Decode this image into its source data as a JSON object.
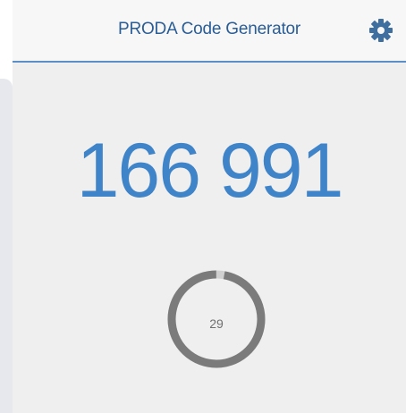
{
  "header": {
    "title": "PRODA Code Generator",
    "settings_icon": "gear-icon"
  },
  "code": {
    "value": "166 991"
  },
  "timer": {
    "seconds_remaining": "29",
    "progress": 0.97
  },
  "colors": {
    "accent": "#3f83c8",
    "title": "#2a5d96",
    "ring": "#7b7b7b",
    "ring_track": "#d0d0d0"
  }
}
